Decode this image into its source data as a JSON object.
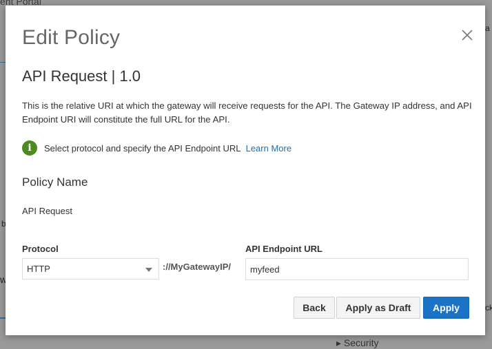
{
  "background": {
    "portal_title_fragment": "ent Portal",
    "left_fragment_b": "b",
    "left_fragment_w": "w",
    "right_fragment_a": "a",
    "right_fragment_b": "ck",
    "security_fragment": "▸ Security"
  },
  "dialog": {
    "title": "Edit Policy",
    "close_icon": "close-icon",
    "section_title": "API Request | 1.0",
    "description": "This is the relative URI at which the gateway will receive requests for the API. The Gateway IP address, and API Endpoint URI will constitute the full URL for the API.",
    "info": {
      "icon": "info-icon",
      "icon_color": "#4e8b1f",
      "text": "Select protocol and specify the API Endpoint URL",
      "link": "Learn More"
    },
    "policy_name_label": "Policy Name",
    "policy_name_value": "API Request",
    "protocol": {
      "label": "Protocol",
      "selected": "HTTP"
    },
    "gateway_text": "://MyGatewayIP/",
    "endpoint": {
      "label": "API Endpoint URL",
      "value": "myfeed"
    },
    "buttons": {
      "back": "Back",
      "apply_as_draft": "Apply as Draft",
      "apply": "Apply"
    },
    "colors": {
      "primary": "#1a73c4",
      "link": "#1f6fb2"
    }
  }
}
